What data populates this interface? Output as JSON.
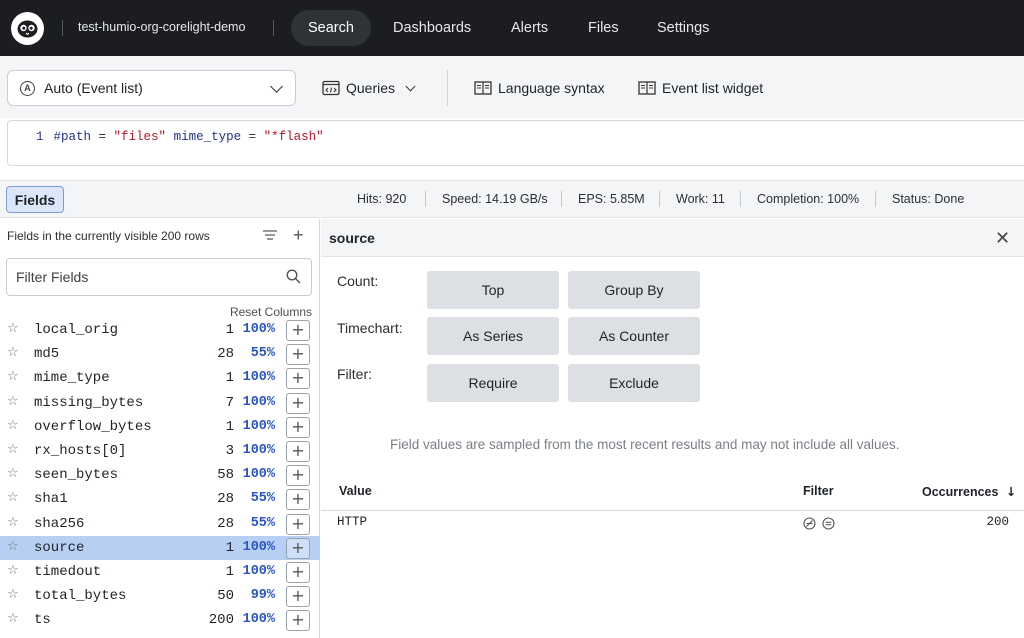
{
  "nav": {
    "org_name": "test-humio-org-corelight-demo",
    "items": [
      {
        "label": "Search",
        "active": true
      },
      {
        "label": "Dashboards",
        "active": false
      },
      {
        "label": "Alerts",
        "active": false
      },
      {
        "label": "Files",
        "active": false
      },
      {
        "label": "Settings",
        "active": false
      }
    ]
  },
  "toolbar": {
    "mode_label": "Auto (Event list)",
    "mode_icon_letter": "A",
    "queries_label": "Queries",
    "language_syntax_label": "Language syntax",
    "event_list_widget_label": "Event list widget"
  },
  "editor": {
    "line_number": "1",
    "query_tokens": [
      {
        "text": "#path",
        "kind": "kw"
      },
      {
        "text": " = ",
        "kind": "op"
      },
      {
        "text": "\"files\"",
        "kind": "str"
      },
      {
        "text": " mime_type",
        "kind": "kw"
      },
      {
        "text": " = ",
        "kind": "op"
      },
      {
        "text": "\"*flash\"",
        "kind": "str"
      }
    ]
  },
  "stats": {
    "fields_tab_label": "Fields",
    "hits": "Hits: 920",
    "speed": "Speed: 14.19 GB/s",
    "eps": "EPS: 5.85M",
    "work": "Work: 11",
    "completion": "Completion: 100%",
    "status": "Status: Done"
  },
  "fields_panel": {
    "header": "Fields in the currently visible 200 rows",
    "filter_placeholder": "Filter Fields",
    "reset_columns_label": "Reset Columns",
    "rows": [
      {
        "name": "local_orig",
        "count": "1",
        "pct": "100%",
        "selected": false
      },
      {
        "name": "md5",
        "count": "28",
        "pct": "55%",
        "selected": false
      },
      {
        "name": "mime_type",
        "count": "1",
        "pct": "100%",
        "selected": false
      },
      {
        "name": "missing_bytes",
        "count": "7",
        "pct": "100%",
        "selected": false
      },
      {
        "name": "overflow_bytes",
        "count": "1",
        "pct": "100%",
        "selected": false
      },
      {
        "name": "rx_hosts[0]",
        "count": "3",
        "pct": "100%",
        "selected": false
      },
      {
        "name": "seen_bytes",
        "count": "58",
        "pct": "100%",
        "selected": false
      },
      {
        "name": "sha1",
        "count": "28",
        "pct": "55%",
        "selected": false
      },
      {
        "name": "sha256",
        "count": "28",
        "pct": "55%",
        "selected": false
      },
      {
        "name": "source",
        "count": "1",
        "pct": "100%",
        "selected": true
      },
      {
        "name": "timedout",
        "count": "1",
        "pct": "100%",
        "selected": false
      },
      {
        "name": "total_bytes",
        "count": "50",
        "pct": "99%",
        "selected": false
      },
      {
        "name": "ts",
        "count": "200",
        "pct": "100%",
        "selected": false
      }
    ]
  },
  "detail": {
    "title": "source",
    "count_label": "Count:",
    "timechart_label": "Timechart:",
    "filter_label": "Filter:",
    "buttons": {
      "top": "Top",
      "group_by": "Group By",
      "as_series": "As Series",
      "as_counter": "As Counter",
      "require": "Require",
      "exclude": "Exclude"
    },
    "note": "Field values are sampled from the most recent results and may not include all values.",
    "table": {
      "col_value": "Value",
      "col_filter": "Filter",
      "col_occurrences": "Occurrences",
      "rows": [
        {
          "value": "HTTP",
          "occurrences": "200"
        }
      ]
    }
  }
}
